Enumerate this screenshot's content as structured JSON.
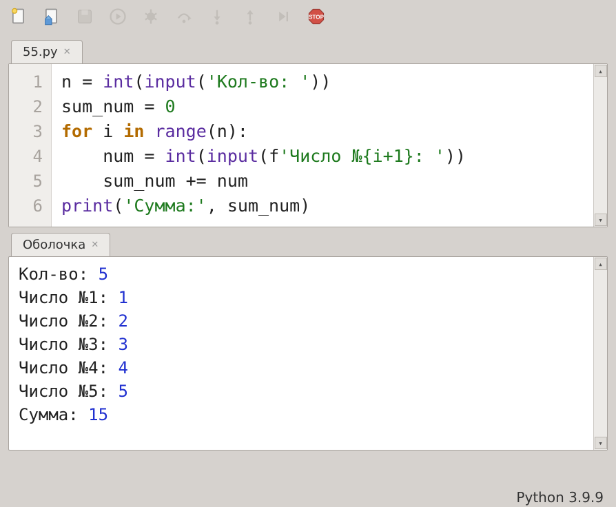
{
  "toolbar": {
    "icons": [
      "new-file",
      "open-file",
      "save-file",
      "run",
      "debug",
      "step-over",
      "step-into",
      "step-out",
      "resume",
      "stop"
    ]
  },
  "editor": {
    "tab_label": "55.py",
    "line_numbers": [
      "1",
      "2",
      "3",
      "4",
      "5",
      "6"
    ],
    "code_tokens": [
      [
        {
          "t": "n ",
          "c": "var"
        },
        {
          "t": "= ",
          "c": "var"
        },
        {
          "t": "int",
          "c": "fn"
        },
        {
          "t": "(",
          "c": "var"
        },
        {
          "t": "input",
          "c": "fn"
        },
        {
          "t": "(",
          "c": "var"
        },
        {
          "t": "'Кол-во: '",
          "c": "str"
        },
        {
          "t": "))",
          "c": "var"
        }
      ],
      [
        {
          "t": "sum_num ",
          "c": "var"
        },
        {
          "t": "= ",
          "c": "var"
        },
        {
          "t": "0",
          "c": "num"
        }
      ],
      [
        {
          "t": "for",
          "c": "kw"
        },
        {
          "t": " i ",
          "c": "var"
        },
        {
          "t": "in",
          "c": "kw"
        },
        {
          "t": " ",
          "c": "var"
        },
        {
          "t": "range",
          "c": "fn"
        },
        {
          "t": "(n):",
          "c": "var"
        }
      ],
      [
        {
          "t": "    num ",
          "c": "var"
        },
        {
          "t": "= ",
          "c": "var"
        },
        {
          "t": "int",
          "c": "fn"
        },
        {
          "t": "(",
          "c": "var"
        },
        {
          "t": "input",
          "c": "fn"
        },
        {
          "t": "(f",
          "c": "var"
        },
        {
          "t": "'Число №{i+1}: '",
          "c": "str"
        },
        {
          "t": "))",
          "c": "var"
        }
      ],
      [
        {
          "t": "    sum_num ",
          "c": "var"
        },
        {
          "t": "+= ",
          "c": "var"
        },
        {
          "t": "num",
          "c": "var"
        }
      ],
      [
        {
          "t": "print",
          "c": "fn"
        },
        {
          "t": "(",
          "c": "var"
        },
        {
          "t": "'Сумма:'",
          "c": "str"
        },
        {
          "t": ", sum_num)",
          "c": "var"
        }
      ]
    ]
  },
  "shell": {
    "tab_label": "Оболочка",
    "lines": [
      {
        "prompt": "Кол-во: ",
        "value": "5"
      },
      {
        "prompt": "Число №1: ",
        "value": "1"
      },
      {
        "prompt": "Число №2: ",
        "value": "2"
      },
      {
        "prompt": "Число №3: ",
        "value": "3"
      },
      {
        "prompt": "Число №4: ",
        "value": "4"
      },
      {
        "prompt": "Число №5: ",
        "value": "5"
      },
      {
        "prompt": "Сумма: ",
        "value": "15"
      }
    ]
  },
  "status": {
    "python_version": "Python 3.9.9"
  }
}
